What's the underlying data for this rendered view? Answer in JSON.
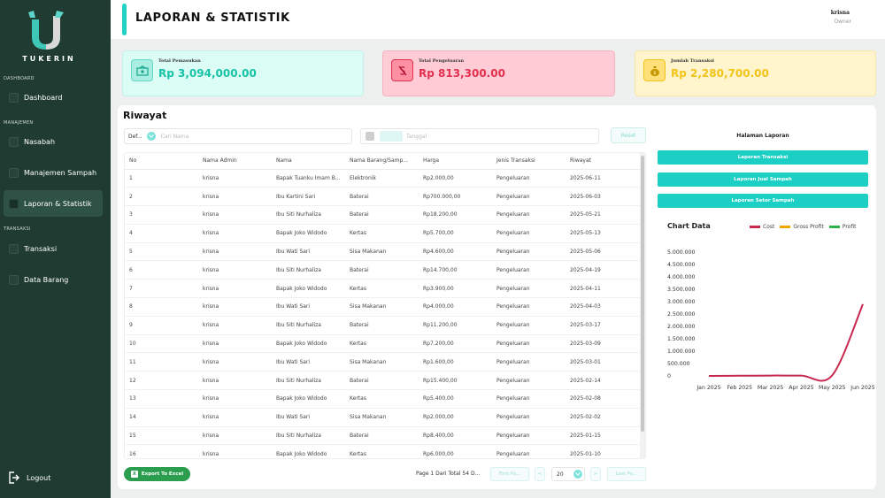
{
  "app": {
    "brand": "TUKERIN"
  },
  "sidebar": {
    "sections": {
      "dashboard": "DASHBOARD",
      "manajemen": "MANAJEMEN",
      "transaksi": "TRANSAKSI"
    },
    "items": [
      {
        "label": "Dashboard"
      },
      {
        "label": "Nasabah"
      },
      {
        "label": "Manajemen Sampah"
      },
      {
        "label": "Laporan & Statistik"
      },
      {
        "label": "Transaksi"
      },
      {
        "label": "Data Barang"
      }
    ],
    "logout": "Logout"
  },
  "header": {
    "title": "LAPORAN & STATISTIK",
    "user_name": "krisna",
    "user_role": "Owner"
  },
  "stats": [
    {
      "label": "Total Pemasukan",
      "value": "Rp 3,094,000.00",
      "color": "#17c3a6"
    },
    {
      "label": "Total Pengeluaran",
      "value": "Rp 813,300.00",
      "color": "#e2304f"
    },
    {
      "label": "Jumlah Transaksi",
      "value": "Rp 2,280,700.00",
      "color": "#f0c419"
    }
  ],
  "riwayat": {
    "title": "Riwayat",
    "filter_default": "Def...",
    "search_placeholder": "Cari Nama",
    "date_placeholder": "Tanggal",
    "reset_label": "Reset",
    "columns": [
      "No",
      "Nama Admin",
      "Nama",
      "Nama Barang/Samp...",
      "Harga",
      "Jenis Transaksi",
      "Riwayat"
    ],
    "rows": [
      [
        "1",
        "krisna",
        "Bapak Tuanku Imam B...",
        "Elektronik",
        "Rp2.000,00",
        "Pengeluaran",
        "2025-06-11"
      ],
      [
        "2",
        "krisna",
        "Ibu Kartini Sari",
        "Baterai",
        "Rp700.000,00",
        "Pengeluaran",
        "2025-06-03"
      ],
      [
        "3",
        "krisna",
        "Ibu Siti Nurhaliza",
        "Baterai",
        "Rp18.200,00",
        "Pengeluaran",
        "2025-05-21"
      ],
      [
        "4",
        "krisna",
        "Bapak Joko Widodo",
        "Kertas",
        "Rp5.700,00",
        "Pengeluaran",
        "2025-05-13"
      ],
      [
        "5",
        "krisna",
        "Ibu Wati Sari",
        "Sisa Makanan",
        "Rp4.600,00",
        "Pengeluaran",
        "2025-05-06"
      ],
      [
        "6",
        "krisna",
        "Ibu Siti Nurhaliza",
        "Baterai",
        "Rp14.700,00",
        "Pengeluaran",
        "2025-04-19"
      ],
      [
        "7",
        "krisna",
        "Bapak Joko Widodo",
        "Kertas",
        "Rp3.900,00",
        "Pengeluaran",
        "2025-04-11"
      ],
      [
        "8",
        "krisna",
        "Ibu Wati Sari",
        "Sisa Makanan",
        "Rp4.000,00",
        "Pengeluaran",
        "2025-04-03"
      ],
      [
        "9",
        "krisna",
        "Ibu Siti Nurhaliza",
        "Baterai",
        "Rp11.200,00",
        "Pengeluaran",
        "2025-03-17"
      ],
      [
        "10",
        "krisna",
        "Bapak Joko Widodo",
        "Kertas",
        "Rp7.200,00",
        "Pengeluaran",
        "2025-03-09"
      ],
      [
        "11",
        "krisna",
        "Ibu Wati Sari",
        "Sisa Makanan",
        "Rp1.600,00",
        "Pengeluaran",
        "2025-03-01"
      ],
      [
        "12",
        "krisna",
        "Ibu Siti Nurhaliza",
        "Baterai",
        "Rp15.400,00",
        "Pengeluaran",
        "2025-02-14"
      ],
      [
        "13",
        "krisna",
        "Bapak Joko Widodo",
        "Kertas",
        "Rp5.400,00",
        "Pengeluaran",
        "2025-02-08"
      ],
      [
        "14",
        "krisna",
        "Ibu Wati Sari",
        "Sisa Makanan",
        "Rp2.000,00",
        "Pengeluaran",
        "2025-02-02"
      ],
      [
        "15",
        "krisna",
        "Ibu Siti Nurhaliza",
        "Baterai",
        "Rp8.400,00",
        "Pengeluaran",
        "2025-01-15"
      ],
      [
        "16",
        "krisna",
        "Bapak Joko Widodo",
        "Kertas",
        "Rp6.000,00",
        "Pengeluaran",
        "2025-01-10"
      ]
    ],
    "export_label": "Export To Excel",
    "page_info": "Page 1 Dari Total 54 D...",
    "first_page": "First Pa...",
    "prev": "<",
    "page_size": "20",
    "next": ">",
    "last_page": "Last Pa..."
  },
  "laporan": {
    "title": "Halaman Laporan",
    "buttons": [
      "Laporan Transaksi",
      "Laporan Jual Sampah",
      "Laporan Setor Sampah"
    ]
  },
  "chart_data": {
    "type": "line",
    "title": "Chart Data",
    "x": [
      "Jan 2025",
      "Feb 2025",
      "Mar 2025",
      "Apr 2025",
      "May 2025",
      "Jun 2025"
    ],
    "ylim": [
      0,
      5000000
    ],
    "yticks": [
      "0",
      "500.000",
      "1.000.000",
      "1.500.000",
      "2.000.000",
      "2.500.000",
      "3.000.000",
      "3.500.000",
      "4.000.000",
      "4.500.000",
      "5.000.000"
    ],
    "legend_position": "top-right",
    "series": [
      {
        "name": "Cost",
        "color": "#c8294f",
        "values": [
          2000,
          7200,
          15400,
          14700,
          18200,
          2900000
        ]
      },
      {
        "name": "Gross Profit",
        "color": "#f0a500",
        "values": []
      },
      {
        "name": "Profit",
        "color": "#2bb04a",
        "values": []
      }
    ]
  }
}
